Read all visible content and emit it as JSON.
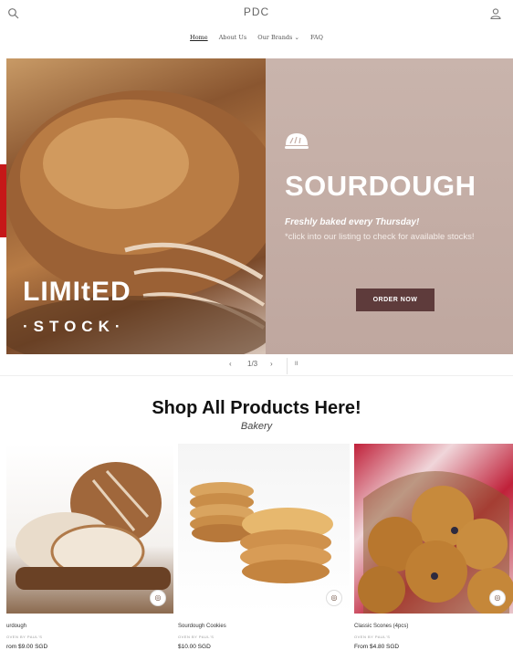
{
  "header": {
    "brand": "PDC",
    "nav": [
      "Home",
      "About Us",
      "Our Brands ⌄",
      "FAQ"
    ]
  },
  "banner": {
    "title": "SOURDOUGH",
    "subtitle": "Freshly baked every Thursday!",
    "note": "*click into our listing to check for available stocks!",
    "button": "ORDER NOW",
    "limited": "LIMItED",
    "stock": "·STOCK·",
    "bread_color": "#8a5630",
    "button_color": "#5e3b3b"
  },
  "slider": {
    "prev": "‹",
    "counter": "1/3",
    "next": "›",
    "pause": "II"
  },
  "section": {
    "title": "Shop All Products Here!",
    "subtitle": "Bakery"
  },
  "products": [
    {
      "name": "urdough",
      "vendor": "OVEN BY PAUL'S",
      "price": "rom $9.00 SGD"
    },
    {
      "name": "Sourdough Cookies",
      "vendor": "OVEN BY PAUL'S",
      "price": "$10.00 SGD"
    },
    {
      "name": "Classic Scones (4pcs)",
      "vendor": "OVEN BY PAUL'S",
      "price": "From $4.80 SGD"
    }
  ]
}
